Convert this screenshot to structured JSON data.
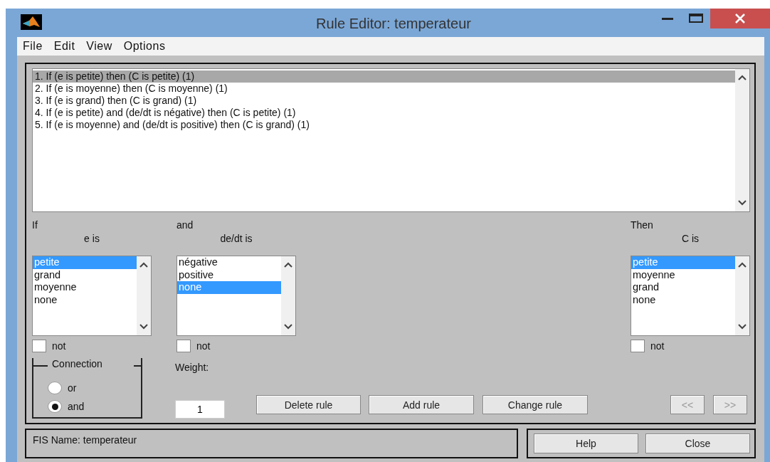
{
  "window": {
    "title": "Rule Editor: temperateur"
  },
  "menu": [
    "File",
    "Edit",
    "View",
    "Options"
  ],
  "rules": [
    {
      "text": "1. If (e is petite) then (C is petite) (1)",
      "selected": true
    },
    {
      "text": "2. If (e is moyenne) then (C is moyenne) (1)",
      "selected": false
    },
    {
      "text": "3. If (e is grand) then (C is grand) (1)",
      "selected": false
    },
    {
      "text": "4. If (e is petite) and (de/dt is négative) then (C is petite) (1)",
      "selected": false
    },
    {
      "text": "5. If (e is moyenne) and (de/dt is positive) then (C is grand) (1)",
      "selected": false
    }
  ],
  "inputs": [
    {
      "heading": "If",
      "variable": "e is",
      "items": [
        {
          "text": "petite",
          "selected": true
        },
        {
          "text": "grand",
          "selected": false
        },
        {
          "text": "moyenne",
          "selected": false
        },
        {
          "text": "none",
          "selected": false
        }
      ],
      "not": {
        "label": "not",
        "checked": false
      }
    },
    {
      "heading": "and",
      "variable": "de/dt is",
      "items": [
        {
          "text": "négative",
          "selected": false
        },
        {
          "text": "positive",
          "selected": false
        },
        {
          "text": "none",
          "selected": true
        }
      ],
      "not": {
        "label": "not",
        "checked": false
      }
    }
  ],
  "output": {
    "heading": "Then",
    "variable": "C is",
    "items": [
      {
        "text": "petite",
        "selected": true
      },
      {
        "text": "moyenne",
        "selected": false
      },
      {
        "text": "grand",
        "selected": false
      },
      {
        "text": "none",
        "selected": false
      }
    ],
    "not": {
      "label": "not",
      "checked": false
    }
  },
  "connection": {
    "title": "Connection",
    "options": [
      {
        "label": "or",
        "selected": false
      },
      {
        "label": "and",
        "selected": true
      }
    ]
  },
  "weight": {
    "label": "Weight:",
    "value": "1"
  },
  "buttons": [
    {
      "label": "Delete rule",
      "disabled": false
    },
    {
      "label": "Add rule",
      "disabled": false
    },
    {
      "label": "Change rule",
      "disabled": false
    }
  ],
  "nav_buttons": [
    {
      "label": "<<",
      "disabled": true
    },
    {
      "label": ">>",
      "disabled": true
    }
  ],
  "status": "FIS Name: temperateur",
  "footer_buttons": [
    "Help",
    "Close"
  ]
}
